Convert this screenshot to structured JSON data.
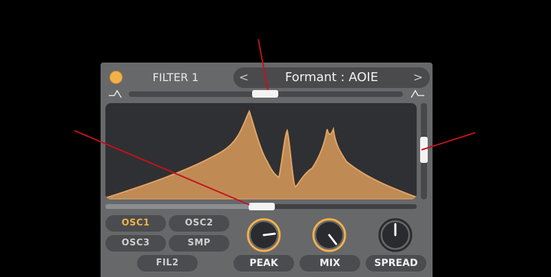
{
  "filter": {
    "title": "FILTER 1",
    "type_prev": "<",
    "type_name": "Formant : AOIE",
    "type_next": ">"
  },
  "sources": [
    {
      "label": "OSC1",
      "active": true
    },
    {
      "label": "OSC2",
      "active": false
    },
    {
      "label": "OSC3",
      "active": false
    },
    {
      "label": "SMP",
      "active": false
    },
    {
      "label": "FIL2",
      "active": false
    }
  ],
  "knobs": [
    {
      "label": "PEAK"
    },
    {
      "label": "MIX"
    },
    {
      "label": "SPREAD"
    }
  ],
  "colors": {
    "accent": "#f4b14a",
    "curve_fill": "#c08a55",
    "annotation": "#c3121b"
  },
  "icons": {
    "left": "lowpass-shape-icon",
    "right": "highpass-shape-icon"
  }
}
